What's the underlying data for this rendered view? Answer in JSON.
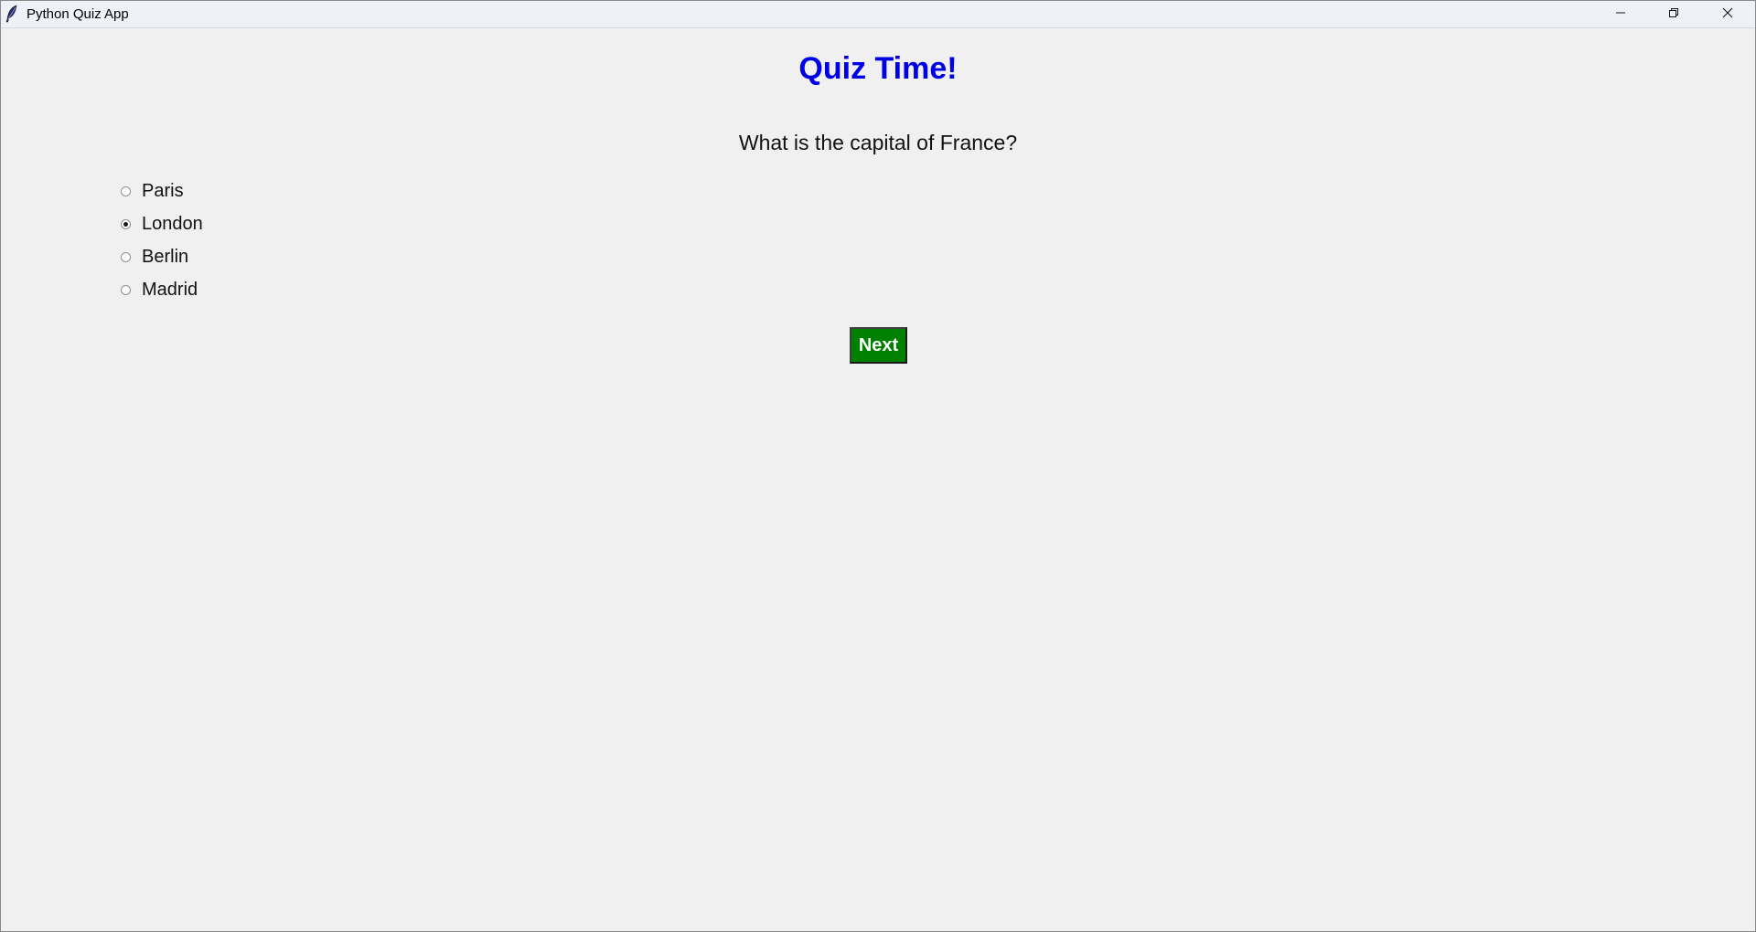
{
  "window": {
    "title": "Python Quiz App",
    "icon": "feather-icon",
    "controls": {
      "minimize_icon": "minimize-icon",
      "restore_icon": "restore-icon",
      "close_icon": "close-icon"
    }
  },
  "quiz": {
    "heading": "Quiz Time!",
    "question": "What is the capital of France?",
    "options": [
      {
        "label": "Paris",
        "selected": false
      },
      {
        "label": "London",
        "selected": true
      },
      {
        "label": "Berlin",
        "selected": false
      },
      {
        "label": "Madrid",
        "selected": false
      }
    ],
    "next_label": "Next"
  },
  "colors": {
    "heading": "#0000e6",
    "next_button_bg": "#008000",
    "next_button_text": "#ffffff",
    "background": "#f0f0f0"
  }
}
